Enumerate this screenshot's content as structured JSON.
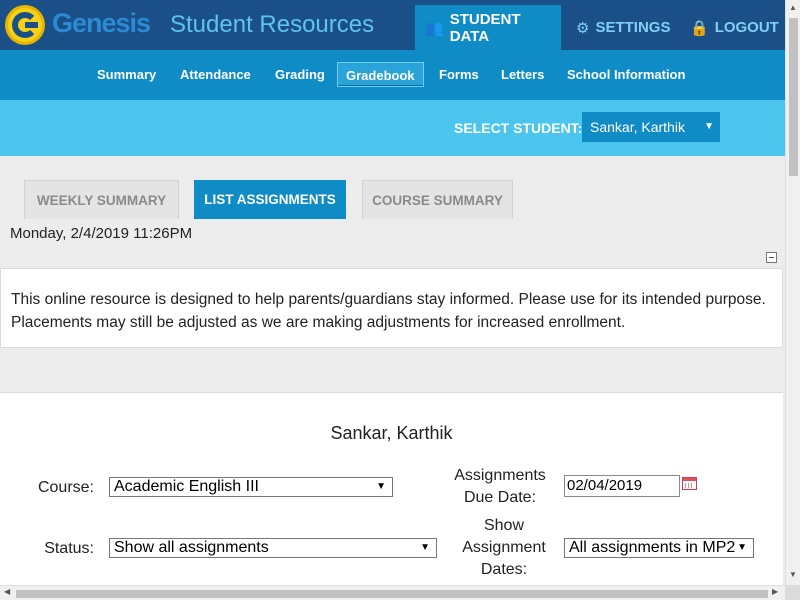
{
  "header": {
    "brand": "Genesis",
    "subtitle": "Student Resources",
    "nav": [
      {
        "label": "STUDENT DATA",
        "icon": "users-icon"
      },
      {
        "label": "SETTINGS",
        "icon": "gear-icon"
      },
      {
        "label": "LOGOUT",
        "icon": "lock-icon"
      }
    ]
  },
  "subnav": {
    "items": [
      "Summary",
      "Attendance",
      "Grading",
      "Gradebook",
      "Forms",
      "Letters",
      "School Information"
    ],
    "active": "Gradebook"
  },
  "student_select": {
    "label": "SELECT STUDENT:",
    "value": "Sankar, Karthik"
  },
  "tabs": [
    {
      "label": "WEEKLY SUMMARY"
    },
    {
      "label": "LIST ASSIGNMENTS"
    },
    {
      "label": "COURSE SUMMARY"
    }
  ],
  "timestamp": "Monday, 2/4/2019 11:26PM",
  "notice": "This online resource is designed to help parents/guardians stay informed. Please use for its intended purpose. Placements may still be adjusted as we are making adjustments for increased enrollment.",
  "form": {
    "student_name": "Sankar, Karthik",
    "course_label": "Course:",
    "course_value": "Academic English III",
    "due_label_1": "Assignments",
    "due_label_2": "Due Date:",
    "due_value": "02/04/2019",
    "status_label": "Status:",
    "status_value": "Show all assignments",
    "show_label_1": "Show",
    "show_label_2": "Assignment",
    "show_label_3": "Dates:",
    "show_value": "All assignments in MP2"
  },
  "colors": {
    "header_dark": "#1b4f88",
    "accent_blue": "#0f8cc5",
    "light_blue": "#4cc5ee",
    "logo_yellow": "#f7d117"
  }
}
